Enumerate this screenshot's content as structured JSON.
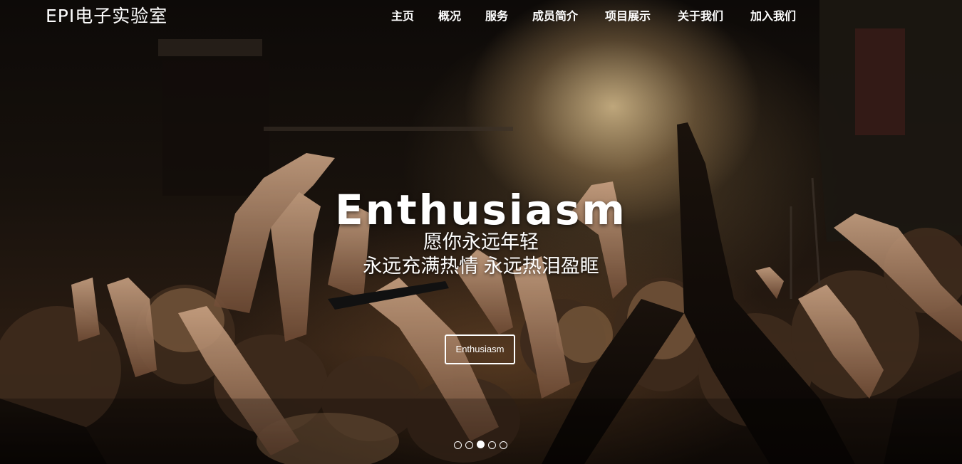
{
  "brand": {
    "logo_text": "EPI电子实验室"
  },
  "nav": {
    "items": [
      {
        "label": "主页"
      },
      {
        "label": "概况"
      },
      {
        "label": "服务"
      },
      {
        "label": "成员简介"
      },
      {
        "label": "项目展示"
      },
      {
        "label": "关于我们"
      },
      {
        "label": "加入我们"
      }
    ]
  },
  "hero": {
    "title": "Enthusiasm",
    "line1": "愿你永远年轻",
    "line2": "永远充满热情 永远热泪盈眶",
    "button_label": "Enthusiasm"
  },
  "carousel": {
    "slide_count": 5,
    "active_index": 2
  },
  "colors": {
    "text": "#ffffff",
    "background": "#0b0806",
    "stage_light": "#d6bc8c"
  }
}
